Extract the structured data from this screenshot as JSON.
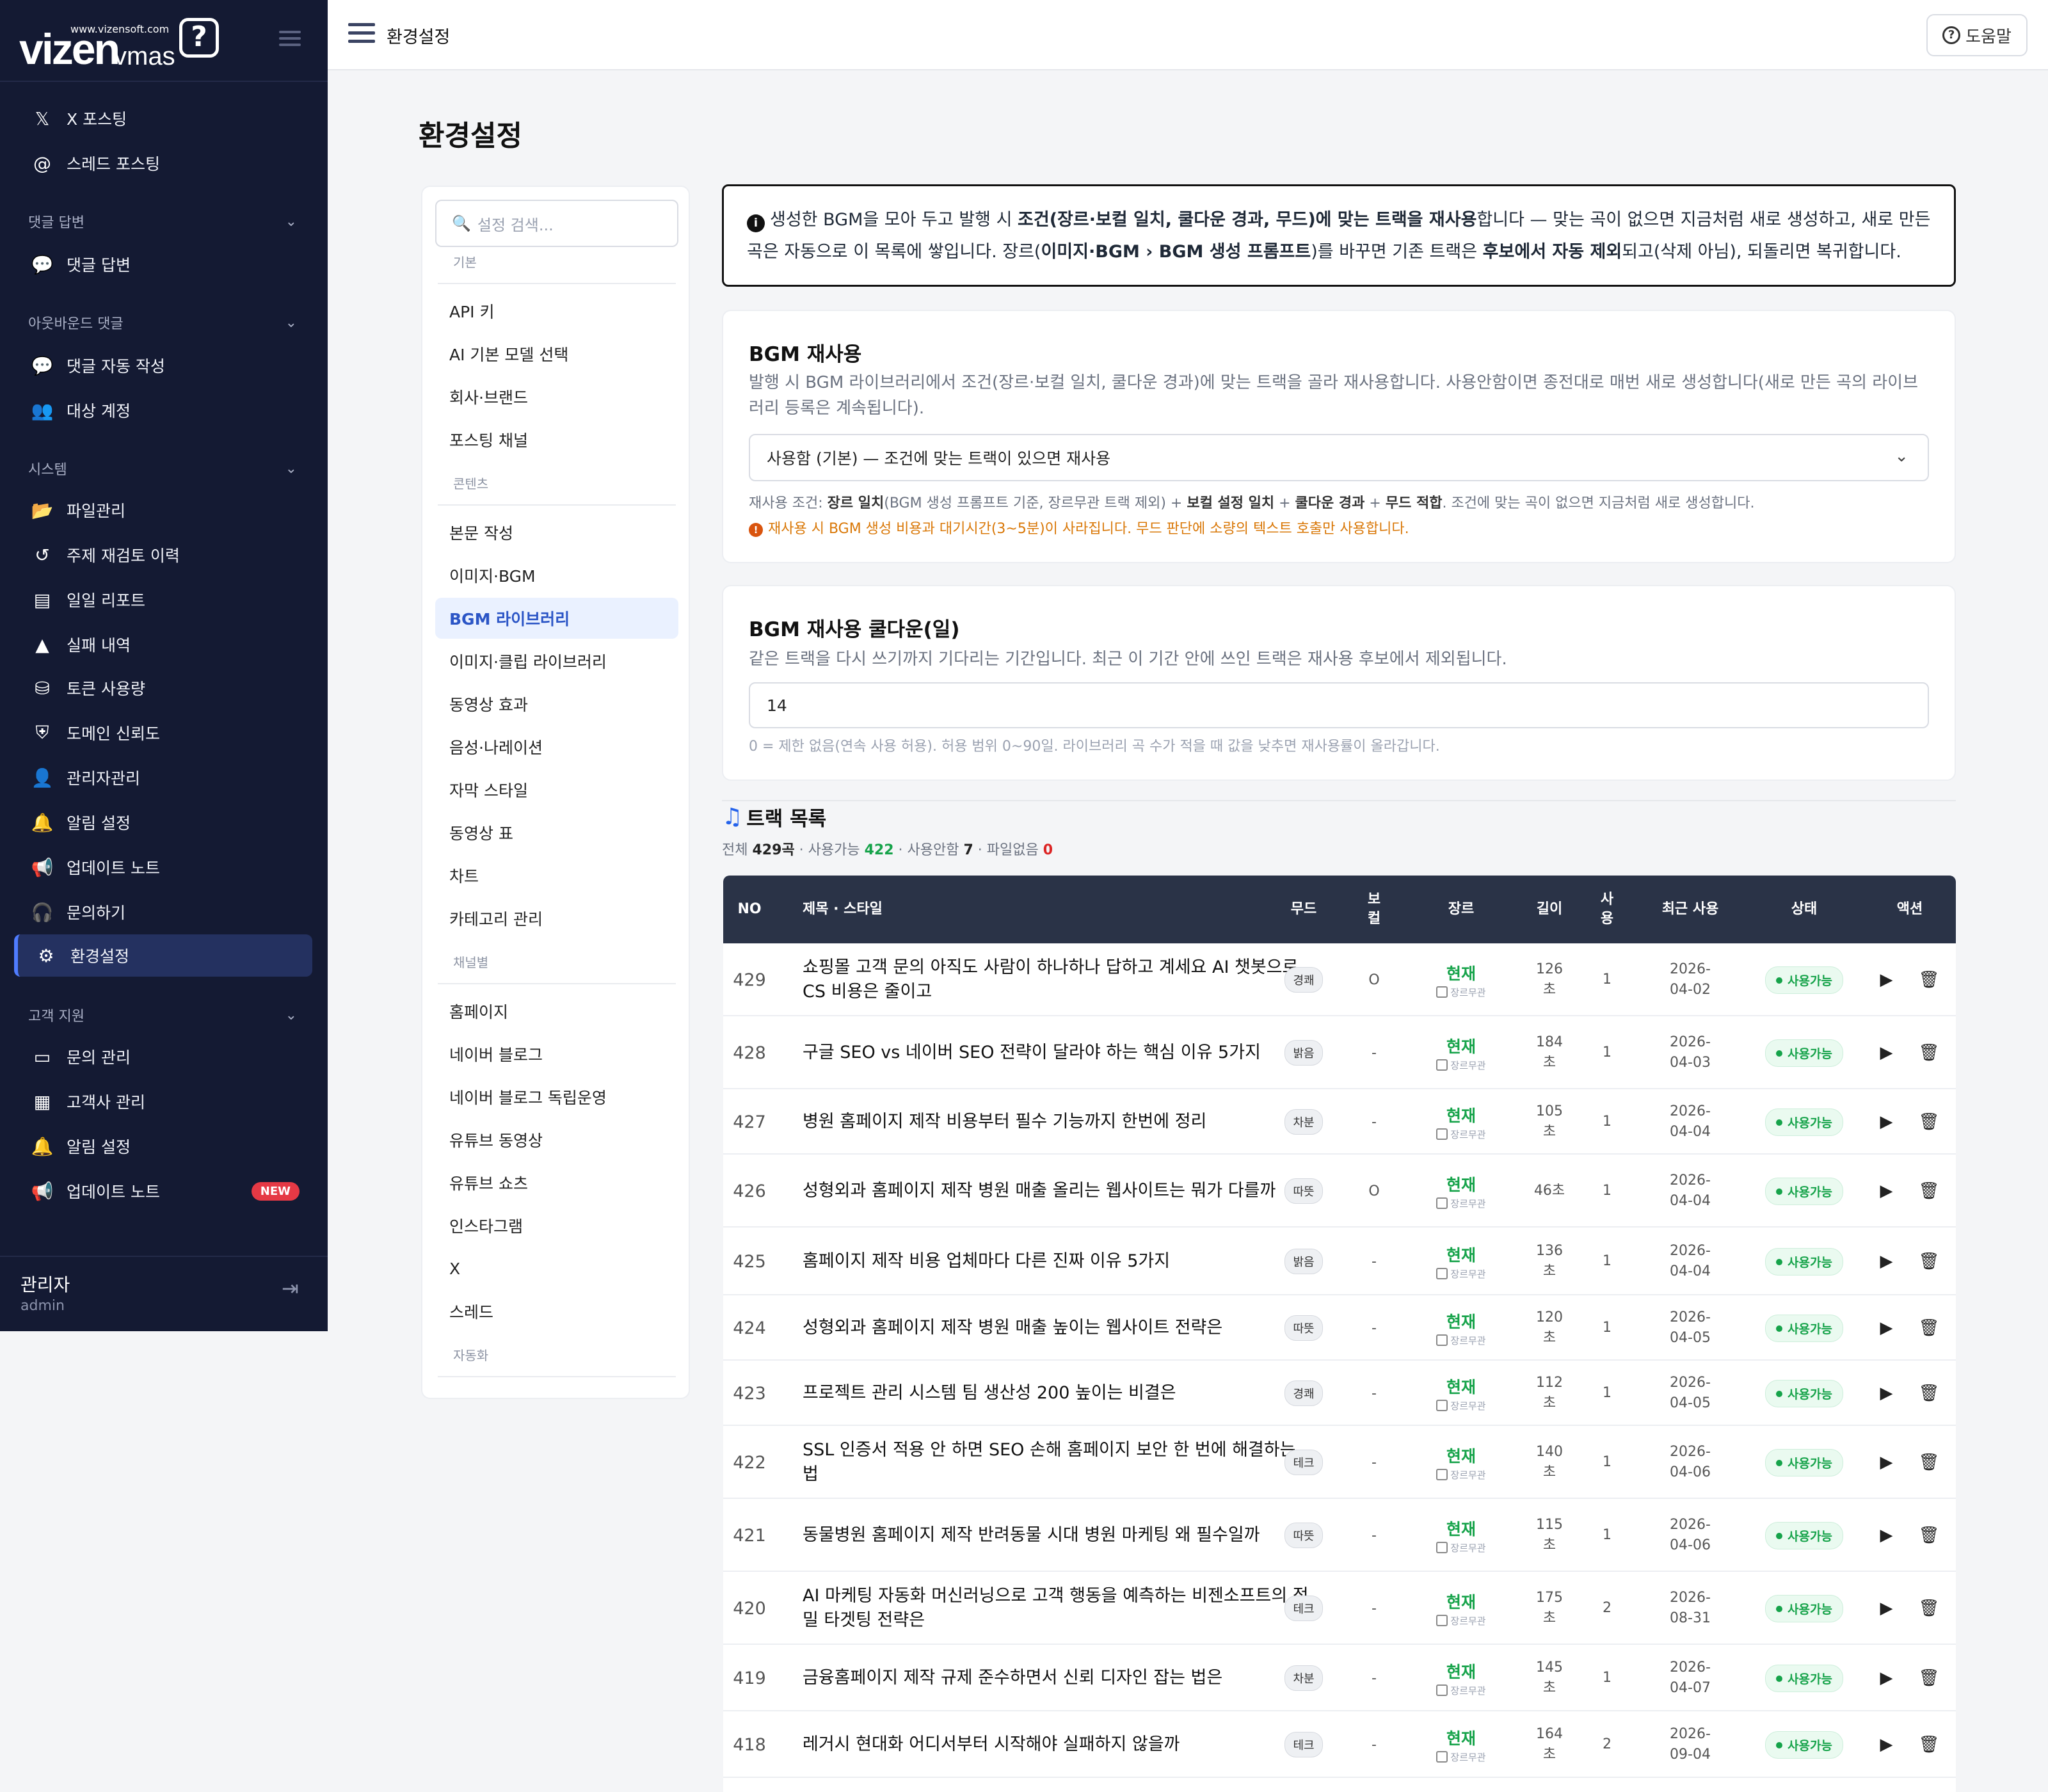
{
  "brand": {
    "site": "www.vizensoft.com",
    "logo_main": "vizen",
    "logo_sub": "vmas",
    "logo_mark": "?"
  },
  "sidebar": {
    "items": [
      {
        "icon": "x-icon",
        "glyph": "𝕏",
        "label": "X 포스팅"
      },
      {
        "icon": "at-icon",
        "glyph": "@",
        "label": "스레드 포스팅"
      },
      {
        "section": "댓글 답변"
      },
      {
        "icon": "comment-icon",
        "glyph": "💬",
        "label": "댓글 답변"
      },
      {
        "section": "아웃바운드 댓글"
      },
      {
        "icon": "comment-icon",
        "glyph": "💬",
        "label": "댓글 자동 작성"
      },
      {
        "icon": "users-icon",
        "glyph": "👥",
        "label": "대상 계정"
      },
      {
        "section": "시스템"
      },
      {
        "icon": "folder-icon",
        "glyph": "📂",
        "label": "파일관리"
      },
      {
        "icon": "history-icon",
        "glyph": "↺",
        "label": "주제 재검토 이력"
      },
      {
        "icon": "chart-icon",
        "glyph": "▤",
        "label": "일일 리포트"
      },
      {
        "icon": "warning-icon",
        "glyph": "▲",
        "label": "실패 내역"
      },
      {
        "icon": "coins-icon",
        "glyph": "⛁",
        "label": "토큰 사용량"
      },
      {
        "icon": "shield-icon",
        "glyph": "⛨",
        "label": "도메인 신뢰도"
      },
      {
        "icon": "user-gear-icon",
        "glyph": "👤",
        "label": "관리자관리"
      },
      {
        "icon": "bell-icon",
        "glyph": "🔔",
        "label": "알림 설정"
      },
      {
        "icon": "megaphone-icon",
        "glyph": "📢",
        "label": "업데이트 노트"
      },
      {
        "icon": "headset-icon",
        "glyph": "🎧",
        "label": "문의하기"
      },
      {
        "icon": "gear-icon",
        "glyph": "⚙",
        "label": "환경설정",
        "active": true
      },
      {
        "section": "고객 지원"
      },
      {
        "icon": "inbox-icon",
        "glyph": "▭",
        "label": "문의 관리"
      },
      {
        "icon": "building-icon",
        "glyph": "▦",
        "label": "고객사 관리"
      },
      {
        "icon": "bell-icon",
        "glyph": "🔔",
        "label": "알림 설정"
      },
      {
        "icon": "megaphone-icon",
        "glyph": "📢",
        "label": "업데이트 노트",
        "badge": "NEW"
      }
    ],
    "user": {
      "name": "관리자",
      "role": "admin"
    }
  },
  "header": {
    "title": "환경설정",
    "help_label": "도움말"
  },
  "page": {
    "title": "환경설정"
  },
  "settings_nav": {
    "search_placeholder": "설정 검색...",
    "entries": [
      {
        "category": "기본"
      },
      {
        "label": "API 키"
      },
      {
        "label": "AI 기본 모델 선택"
      },
      {
        "label": "회사·브랜드"
      },
      {
        "label": "포스팅 채널"
      },
      {
        "category": "콘텐츠"
      },
      {
        "label": "본문 작성"
      },
      {
        "label": "이미지·BGM"
      },
      {
        "label": "BGM 라이브러리",
        "active": true
      },
      {
        "label": "이미지·클립 라이브러리"
      },
      {
        "label": "동영상 효과"
      },
      {
        "label": "음성·나레이션"
      },
      {
        "label": "자막 스타일"
      },
      {
        "label": "동영상 표"
      },
      {
        "label": "차트"
      },
      {
        "label": "카테고리 관리"
      },
      {
        "category": "채널별"
      },
      {
        "label": "홈페이지"
      },
      {
        "label": "네이버 블로그"
      },
      {
        "label": "네이버 블로그 독립운영"
      },
      {
        "label": "유튜브 동영상"
      },
      {
        "label": "유튜브 쇼츠"
      },
      {
        "label": "인스타그램"
      },
      {
        "label": "X"
      },
      {
        "label": "스레드"
      },
      {
        "category": "자동화"
      }
    ]
  },
  "info_html": "생성한 BGM을 모아 두고 발행 시 <b>조건(장르·보컬 일치, 쿨다운 경과, 무드)에 맞는 트랙을 재사용</b>합니다 — 맞는 곡이 없으면 지금처럼 새로 생성하고, 새로 만든 곡은 자동으로 이 목록에 쌓입니다. 장르(<b>이미지·BGM › BGM 생성 프롬프트</b>)를 바꾸면 기존 트랙은 <b>후보에서 자동 제외</b>되고(삭제 아님), 되돌리면 복귀합니다.",
  "reuse": {
    "title": "BGM 재사용",
    "desc": "발행 시 BGM 라이브러리에서 조건(장르·보컬 일치, 쿨다운 경과)에 맞는 트랙을 골라 재사용합니다. 사용안함이면 종전대로 매번 새로 생성합니다(새로 만든 곡의 라이브러리 등록은 계속됩니다).",
    "select_value": "사용함 (기본) — 조건에 맞는 트랙이 있으면 재사용",
    "condition_html": "재사용 조건: <b>장르 일치</b>(BGM 생성 프롬프트 기준, 장르무관 트랙 제외) + <b>보컬 설정 일치</b> + <b>쿨다운 경과</b> + <b>무드 적합</b>. 조건에 맞는 곡이 없으면 지금처럼 새로 생성합니다.",
    "warning": "재사용 시 BGM 생성 비용과 대기시간(3~5분)이 사라집니다. 무드 판단에 소량의 텍스트 호출만 사용합니다."
  },
  "cooldown": {
    "title": "BGM 재사용 쿨다운(일)",
    "desc": "같은 트랙을 다시 쓰기까지 기다리는 기간입니다. 최근 이 기간 안에 쓰인 트랙은 재사용 후보에서 제외됩니다.",
    "value": "14",
    "hint": "0 = 제한 없음(연속 사용 허용). 허용 범위 0~90일. 라이브러리 곡 수가 적을 때 값을 낮추면 재사용률이 올라갑니다."
  },
  "tracks": {
    "title": "트랙 목록",
    "stats": {
      "total_label": "전체",
      "total": "429곡",
      "avail_label": "사용가능",
      "avail": "422",
      "unused_label": "사용안함",
      "unused": "7",
      "nofile_label": "파일없음",
      "nofile": "0"
    },
    "headers": [
      "NO",
      "제목 · 스타일",
      "무드",
      "보\n컬",
      "장르",
      "길이",
      "사\n용",
      "최근 사용",
      "상태",
      "액션"
    ],
    "genre_ignore_label": "장르무관",
    "rows": [
      {
        "no": "429",
        "title": "쇼핑몰 고객 문의 아직도 사람이 하나하나 답하고 계세요 AI 챗봇으로 CS 비용은 줄이고",
        "mood": "경쾌",
        "vocal": "O",
        "genre": "현재",
        "length": "126\n초",
        "used": "1",
        "date": "2026-\n04-02",
        "status": "사용가능"
      },
      {
        "no": "428",
        "title": "구글 SEO vs 네이버 SEO 전략이 달라야 하는 핵심 이유 5가지",
        "mood": "밝음",
        "vocal": "-",
        "genre": "현재",
        "length": "184\n초",
        "used": "1",
        "date": "2026-\n04-03",
        "status": "사용가능"
      },
      {
        "no": "427",
        "title": "병원 홈페이지 제작 비용부터 필수 기능까지 한번에 정리",
        "mood": "차분",
        "vocal": "-",
        "genre": "현재",
        "length": "105\n초",
        "used": "1",
        "date": "2026-\n04-04",
        "status": "사용가능"
      },
      {
        "no": "426",
        "title": "성형외과 홈페이지 제작 병원 매출 올리는 웹사이트는 뭐가 다를까",
        "mood": "따뜻",
        "vocal": "O",
        "genre": "현재",
        "length": "46초",
        "used": "1",
        "date": "2026-\n04-04",
        "status": "사용가능"
      },
      {
        "no": "425",
        "title": "홈페이지 제작 비용 업체마다 다른 진짜 이유 5가지",
        "mood": "밝음",
        "vocal": "-",
        "genre": "현재",
        "length": "136\n초",
        "used": "1",
        "date": "2026-\n04-04",
        "status": "사용가능"
      },
      {
        "no": "424",
        "title": "성형외과 홈페이지 제작 병원 매출 높이는 웹사이트 전략은",
        "mood": "따뜻",
        "vocal": "-",
        "genre": "현재",
        "length": "120\n초",
        "used": "1",
        "date": "2026-\n04-05",
        "status": "사용가능"
      },
      {
        "no": "423",
        "title": "프로젝트 관리 시스템 팀 생산성 200 높이는 비결은",
        "mood": "경쾌",
        "vocal": "-",
        "genre": "현재",
        "length": "112\n초",
        "used": "1",
        "date": "2026-\n04-05",
        "status": "사용가능"
      },
      {
        "no": "422",
        "title": "SSL 인증서 적용 안 하면 SEO 손해 홈페이지 보안 한 번에 해결하는 법",
        "mood": "테크",
        "vocal": "-",
        "genre": "현재",
        "length": "140\n초",
        "used": "1",
        "date": "2026-\n04-06",
        "status": "사용가능"
      },
      {
        "no": "421",
        "title": "동물병원 홈페이지 제작 반려동물 시대 병원 마케팅 왜 필수일까",
        "mood": "따뜻",
        "vocal": "-",
        "genre": "현재",
        "length": "115\n초",
        "used": "1",
        "date": "2026-\n04-06",
        "status": "사용가능"
      },
      {
        "no": "420",
        "title": "AI 마케팅 자동화 머신러닝으로 고객 행동을 예측하는 비젠소프트의 정밀 타겟팅 전략은",
        "mood": "테크",
        "vocal": "-",
        "genre": "현재",
        "length": "175\n초",
        "used": "2",
        "date": "2026-\n08-31",
        "status": "사용가능"
      },
      {
        "no": "419",
        "title": "금융홈페이지 제작 규제 준수하면서 신뢰 디자인 잡는 법은",
        "mood": "차분",
        "vocal": "-",
        "genre": "현재",
        "length": "145\n초",
        "used": "1",
        "date": "2026-\n04-07",
        "status": "사용가능"
      },
      {
        "no": "418",
        "title": "레거시 현대화 어디서부터 시작해야 실패하지 않을까",
        "mood": "테크",
        "vocal": "-",
        "genre": "현재",
        "length": "164\n초",
        "used": "2",
        "date": "2026-\n09-04",
        "status": "사용가능"
      }
    ]
  }
}
